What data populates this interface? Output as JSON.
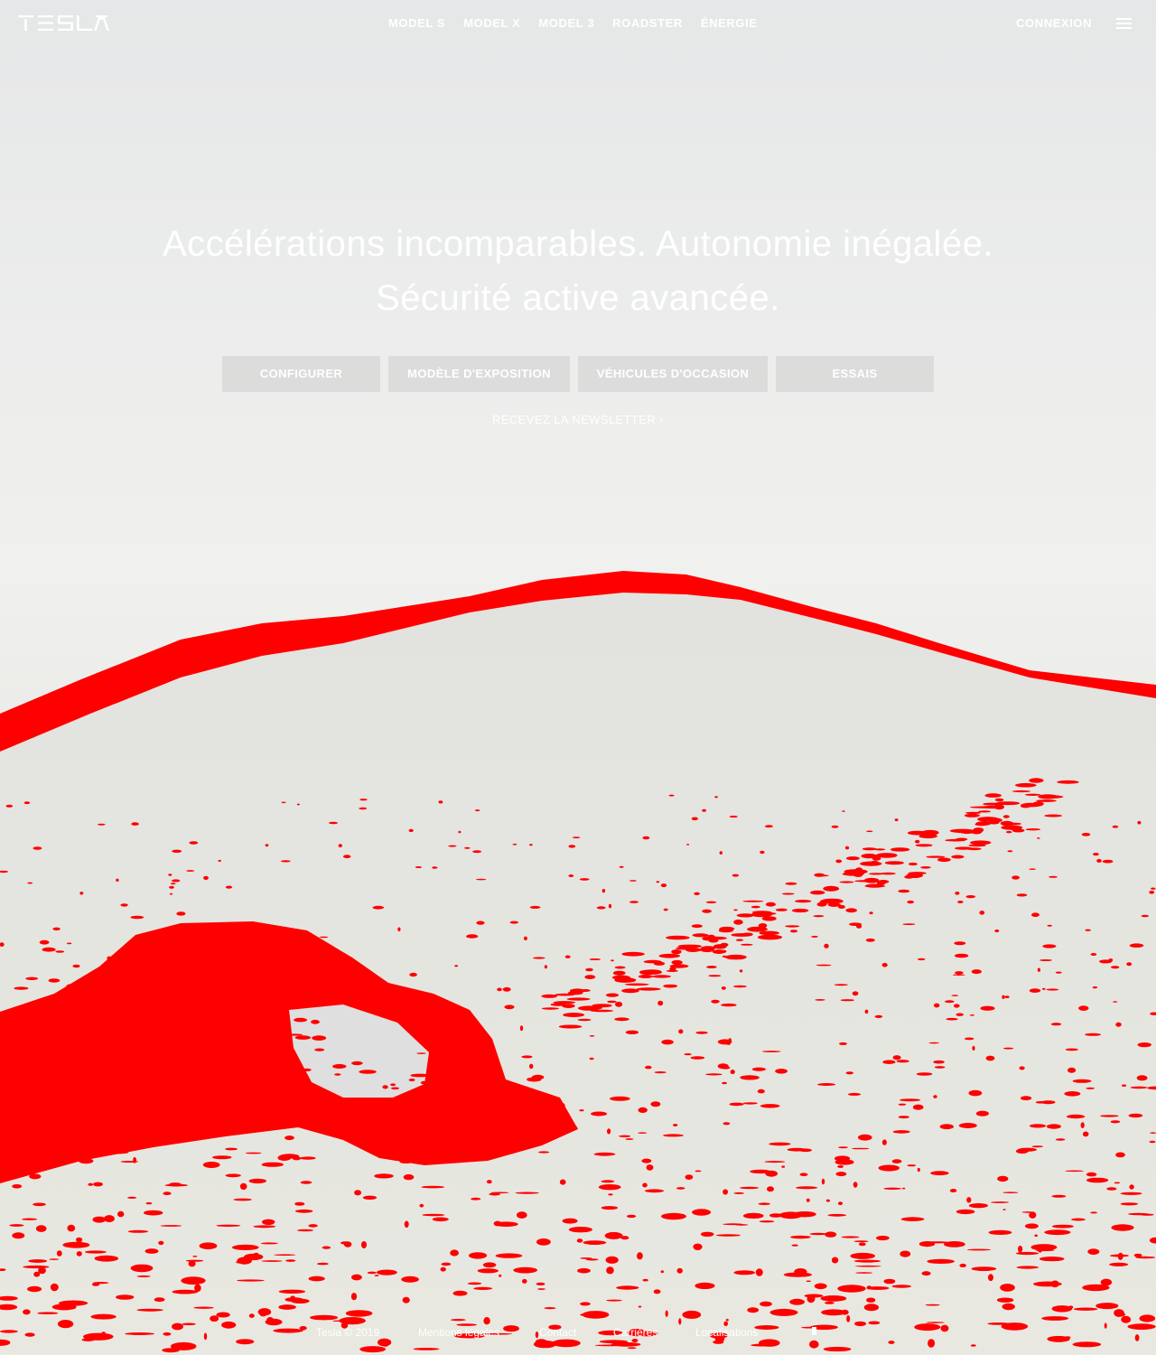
{
  "brand": {
    "logo_text": "TESLA",
    "logo_color": "#ffffff"
  },
  "nav": {
    "items": [
      "MODEL S",
      "MODEL X",
      "MODEL 3",
      "ROADSTER",
      "ÉNERGIE"
    ],
    "signin_label": "CONNEXION",
    "menu_icon": "hamburger-menu-icon"
  },
  "hero": {
    "headline_line1": "Accélérations incomparables. Autonomie inégalée.",
    "headline_line2": "Sécurité active avancée.",
    "buttons": [
      "CONFIGURER",
      "MODÈLE D'EXPOSITION",
      "VÉHICULES D'OCCASION",
      "ESSAIS"
    ],
    "newsletter_label": "RECEVEZ LA NEWSLETTER",
    "newsletter_arrow": "›"
  },
  "footer": {
    "links": [
      "Tesla © 2019",
      "Mentions légales",
      "Contact",
      "Carrières",
      "Localisations"
    ]
  },
  "colors": {
    "overlay_red": "#ff0000",
    "text_white": "#ffffff",
    "button_bg": "#d5d6d6",
    "sky": "#e6e7e8",
    "field": "#e6e6df"
  }
}
